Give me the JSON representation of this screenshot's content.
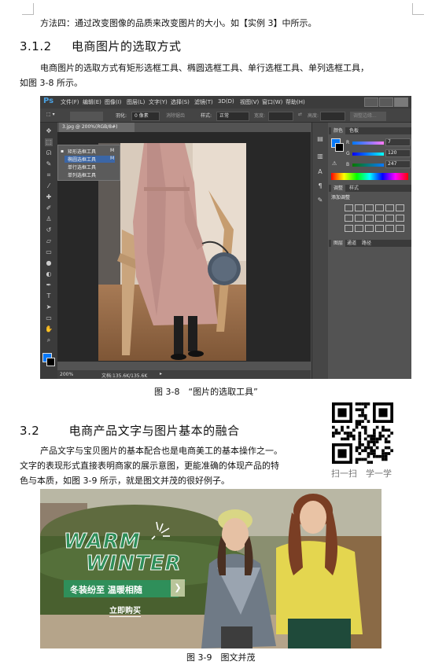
{
  "page": {
    "line1": "方法四：通过改变图像的品质来改变图片的大小。如【实例 3】中所示。",
    "sec312": {
      "num": "3.1.2",
      "title": "电商图片的选取方式"
    },
    "para1_l1": "电商图片的选取方式有矩形选框工具、椭圆选框工具、单行选框工具、单列选框工具，",
    "para1_l2": "如图 3-8 所示。",
    "fig38": "图 3-8　“图片的选取工具”",
    "sec32": {
      "num": "3.2",
      "title": "电商产品文字与图片基本的融合"
    },
    "para2_l1": "产品文字与宝贝图片的基本配合也是电商美工的基本操作之一。",
    "para2_l2": "文字的表现形式直接表明商家的展示意图，更能准确的体现产品的特",
    "para2_l3": "色与本质，如图 3-9 所示，就是图文并茂的很好例子。",
    "qr_caption": "扫一扫　学一学",
    "fig39": "图 3-9　图文并茂"
  },
  "ps": {
    "logo": "Ps",
    "menu": [
      "文件(F)",
      "编辑(E)",
      "图像(I)",
      "图层(L)",
      "文字(Y)",
      "选择(S)",
      "滤镜(T)",
      "3D(D)",
      "视图(V)",
      "窗口(W)",
      "帮助(H)"
    ],
    "options": {
      "feather": "羽化:",
      "feather_val": "0 像素",
      "antialias": "消除锯齿",
      "style": "样式:",
      "style_val": "正常",
      "width": "宽度:",
      "height": "高度:",
      "refine": "调整边缘..."
    },
    "doc_tab": "3.jpg @ 200%(RGB/8#)",
    "flyout": [
      {
        "label": "矩形选框工具",
        "key": "M"
      },
      {
        "label": "椭圆选框工具",
        "key": "M"
      },
      {
        "label": "单行选框工具",
        "key": ""
      },
      {
        "label": "单列选框工具",
        "key": ""
      }
    ],
    "status": {
      "zoom": "200%",
      "doc": "文档:135.6K/135.6K"
    },
    "color_tabs": [
      "颜色",
      "色板"
    ],
    "rgb": [
      {
        "ch": "R",
        "val": "7"
      },
      {
        "ch": "G",
        "val": "120"
      },
      {
        "ch": "B",
        "val": "247"
      }
    ],
    "adj_tabs": [
      "调整",
      "样式"
    ],
    "adj_title": "添加调整",
    "layer_tabs": [
      "图层",
      "通道",
      "路径"
    ],
    "fg_color": "#0778f7"
  },
  "banner": {
    "title1": "WARM",
    "title2": "WINTER",
    "tagline": "冬装纷至 温暖相随",
    "cta": "立即购买",
    "accent": "#2f8f5a"
  }
}
